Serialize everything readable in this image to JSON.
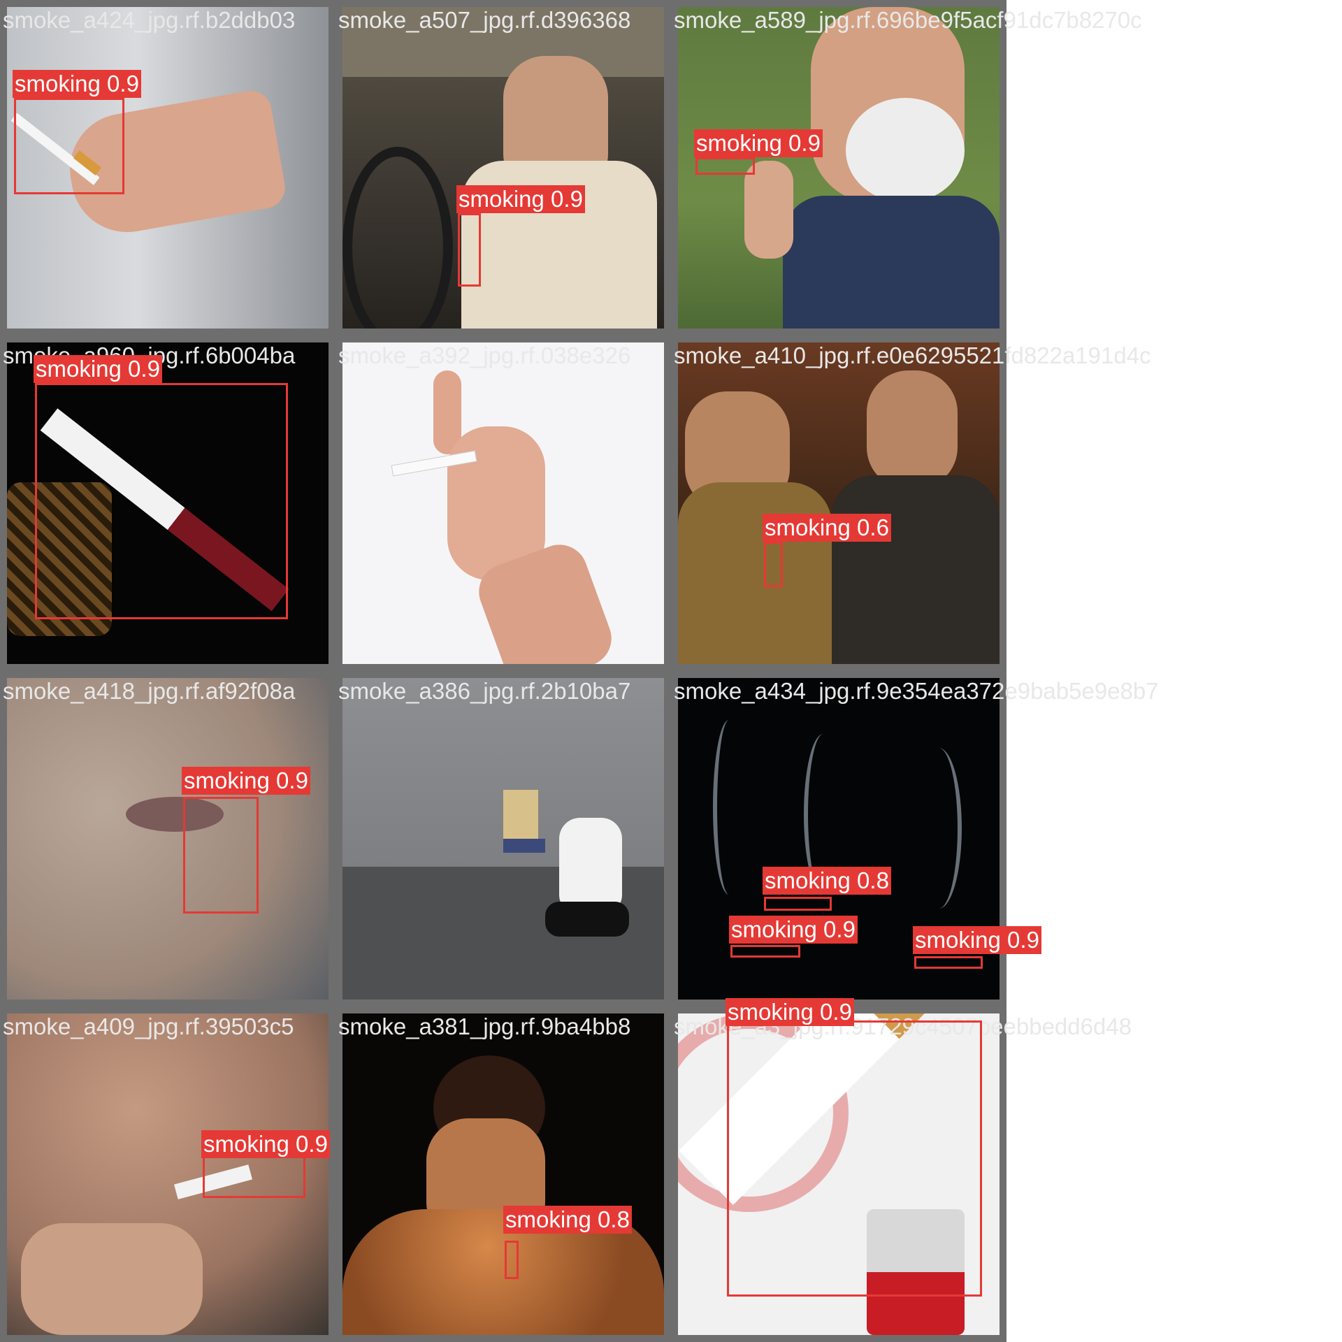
{
  "colors": {
    "box": "#e53935",
    "label_text": "#ffffff",
    "filename_text": "#e8e8e8",
    "tile_border": "#6e6e6e"
  },
  "class_name": "smoking",
  "tiles": [
    {
      "filename": "smoke_a424_jpg.rf.b2ddb03",
      "detections": [
        {
          "label": "smoking 0.9"
        }
      ]
    },
    {
      "filename": "smoke_a507_jpg.rf.d396368",
      "detections": [
        {
          "label": "smoking 0.9"
        }
      ]
    },
    {
      "filename": "smoke_a589_jpg.rf.696be9f5acf91dc7b8270c",
      "detections": [
        {
          "label": "smoking 0.9"
        }
      ]
    },
    {
      "filename": "smoke_a960_jpg.rf.6b004ba",
      "detections": [
        {
          "label": "smoking 0.9"
        }
      ]
    },
    {
      "filename": "smoke_a392_jpg.rf.038e326",
      "detections": []
    },
    {
      "filename": "smoke_a410_jpg.rf.e0e6295521fd822a191d4c",
      "detections": [
        {
          "label": "smoking 0.6"
        }
      ]
    },
    {
      "filename": "smoke_a418_jpg.rf.af92f08a",
      "detections": [
        {
          "label": "smoking 0.9"
        }
      ]
    },
    {
      "filename": "smoke_a386_jpg.rf.2b10ba7",
      "detections": []
    },
    {
      "filename": "smoke_a434_jpg.rf.9e354ea372e9bab5e9e8b7",
      "detections": [
        {
          "label": "smoking 0.8"
        },
        {
          "label": "smoking 0.9"
        },
        {
          "label": "smoking 0.9"
        }
      ]
    },
    {
      "filename": "smoke_a409_jpg.rf.39503c5",
      "detections": [
        {
          "label": "smoking 0.9"
        }
      ]
    },
    {
      "filename": "smoke_a381_jpg.rf.9ba4bb8",
      "detections": [
        {
          "label": "smoking 0.8"
        }
      ]
    },
    {
      "filename": "smoke_a3_jpg.rf.91729c4507beebbedd6d48",
      "detections": [
        {
          "label": "smoking 0.9"
        }
      ]
    }
  ]
}
